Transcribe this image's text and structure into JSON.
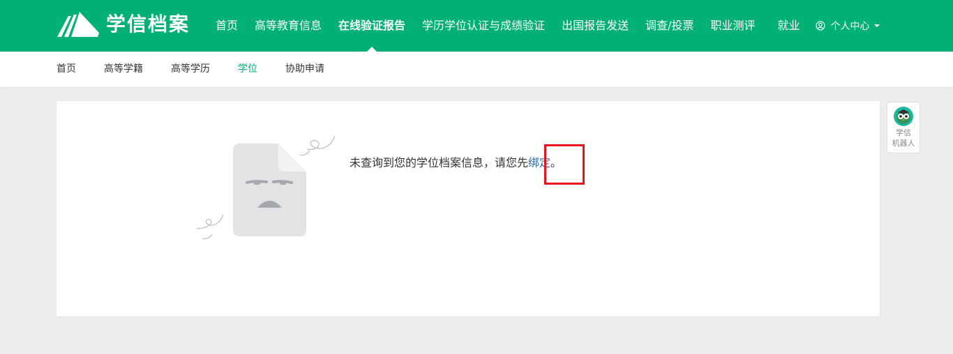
{
  "header": {
    "logo_text": "学信档案",
    "nav": [
      {
        "label": "首页"
      },
      {
        "label": "高等教育信息"
      },
      {
        "label": "在线验证报告",
        "active": true
      },
      {
        "label": "学历学位认证与成绩验证"
      },
      {
        "label": "出国报告发送"
      },
      {
        "label": "调查/投票"
      },
      {
        "label": "职业测评"
      },
      {
        "label": "就业"
      }
    ],
    "user_menu_label": "个人中心",
    "user_icon": "user-circle-icon",
    "caret_icon": "caret-down-icon"
  },
  "subnav": {
    "items": [
      {
        "label": "首页"
      },
      {
        "label": "高等学籍"
      },
      {
        "label": "高等学历"
      },
      {
        "label": "学位",
        "active": true
      },
      {
        "label": "协助申请"
      }
    ]
  },
  "main": {
    "empty_icon": "sad-document-icon",
    "message_prefix": "未查询到您的学位档案信息，请您先",
    "bind_link": "绑定",
    "message_suffix": "。"
  },
  "robot": {
    "icon": "owl-robot-icon",
    "label_line1": "学信",
    "label_line2": "机器人"
  },
  "colors": {
    "brand_green": "#00b075",
    "link_blue": "#2b6bb1",
    "highlight_red": "#e8121b"
  }
}
